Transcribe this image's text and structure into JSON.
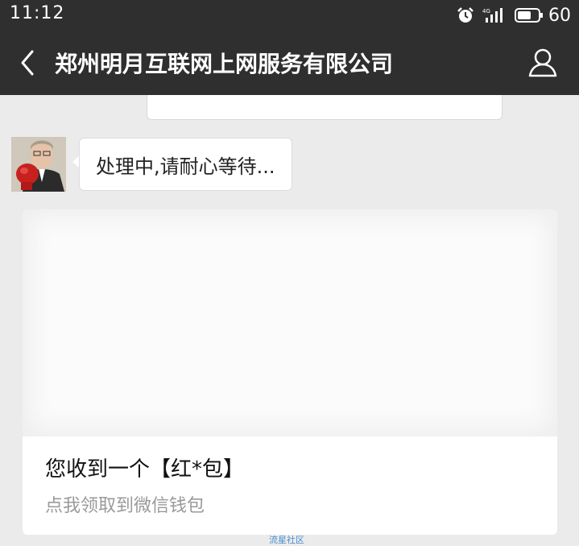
{
  "status_bar": {
    "time": "11:12",
    "network_label": "4G",
    "battery_level": "60",
    "icons": [
      "alarm-icon",
      "signal-icon",
      "battery-icon"
    ]
  },
  "header": {
    "title": "郑州明月互联网上网服务有限公司",
    "back_icon": "back-arrow-icon",
    "profile_icon": "profile-icon"
  },
  "chat": {
    "message_text": "处理中,请耐心等待..."
  },
  "red_packet": {
    "title": "您收到一个【红*包】",
    "subtitle": "点我领取到微信钱包"
  },
  "watermark": "流星社区",
  "colors": {
    "header_bg": "#2f2f2f",
    "chat_bg": "#ebebeb",
    "bubble_bg": "#ffffff",
    "subtitle_gray": "#9a9a9a",
    "watermark_blue": "#4a8fd0"
  }
}
